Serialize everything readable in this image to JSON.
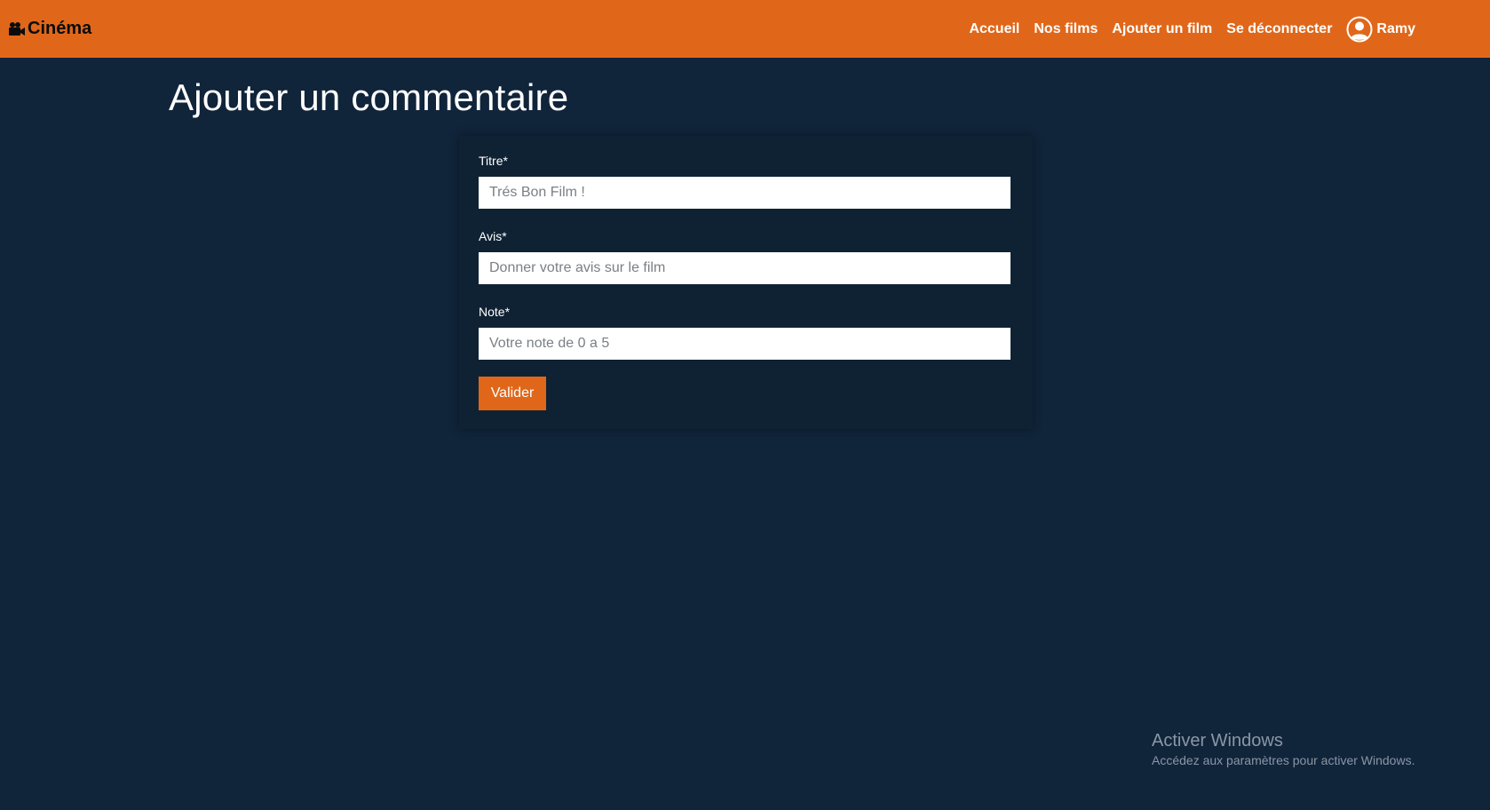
{
  "navbar": {
    "brand": "Cinéma",
    "brand_icon": "video-camera-icon",
    "links": {
      "home": "Accueil",
      "films": "Nos films",
      "add_film": "Ajouter un film",
      "logout": "Se déconnecter"
    },
    "user": {
      "name": "Ramy",
      "icon": "user-circle-icon"
    }
  },
  "main": {
    "title": "Ajouter un commentaire"
  },
  "form": {
    "title_field": {
      "label": "Titre*",
      "placeholder": "Trés Bon Film !",
      "value": ""
    },
    "review_field": {
      "label": "Avis*",
      "placeholder": "Donner votre avis sur le film",
      "value": ""
    },
    "rating_field": {
      "label": "Note*",
      "placeholder": "Votre note de 0 a 5",
      "value": ""
    },
    "submit_label": "Valider"
  },
  "watermark": {
    "title": "Activer Windows",
    "subtitle": "Accédez aux paramètres pour activer Windows."
  },
  "colors": {
    "accent": "#e0671a",
    "background": "#10243a",
    "card": "#0f2234"
  }
}
